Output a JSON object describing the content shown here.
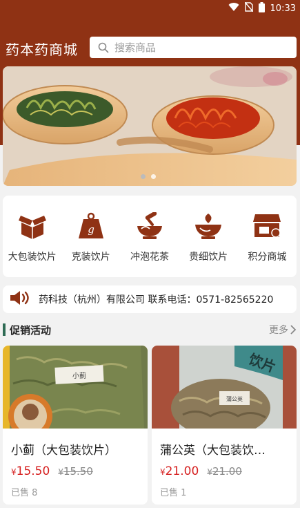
{
  "status_bar": {
    "time": "10:33"
  },
  "header": {
    "app_title": "药本药商城",
    "search_placeholder": "搜索商品"
  },
  "categories": [
    {
      "label": "大包装饮片",
      "icon": "box-icon"
    },
    {
      "label": "克装饮片",
      "icon": "weight-icon"
    },
    {
      "label": "冲泡花茶",
      "icon": "mortar-icon"
    },
    {
      "label": "贵细饮片",
      "icon": "bowl-herb-icon"
    },
    {
      "label": "积分商城",
      "icon": "shop-icon"
    }
  ],
  "notice": {
    "icon": "speaker-icon",
    "text": "药科技（杭州）有限公司 联系电话：0571-82565220"
  },
  "promo": {
    "title": "促销活动",
    "more": "更多"
  },
  "products": [
    {
      "name": "小蓟（大包装饮片）",
      "currency": "¥",
      "price": "15.50",
      "old_price": "15.50",
      "sold": "已售 8",
      "package_label": "小蓟"
    },
    {
      "name": "蒲公英（大包装饮…",
      "currency": "¥",
      "price": "21.00",
      "old_price": "21.00",
      "sold": "已售 1",
      "package_label": "蒲公英"
    }
  ],
  "colors": {
    "brand": "#8f3214",
    "accent_icon": "#8f3214",
    "price_red": "#d61f1f",
    "section_bar": "#2e6b54"
  }
}
